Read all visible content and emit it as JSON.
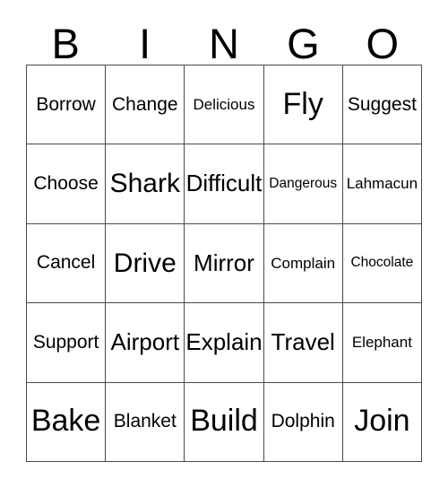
{
  "card": {
    "headers": [
      "B",
      "I",
      "N",
      "G",
      "O"
    ],
    "rows": [
      [
        {
          "text": "Borrow",
          "size": "fs-sm"
        },
        {
          "text": "Change",
          "size": "fs-sm"
        },
        {
          "text": "Delicious",
          "size": "fs-xs"
        },
        {
          "text": "Fly",
          "size": "fs-xl"
        },
        {
          "text": "Suggest",
          "size": "fs-sm"
        }
      ],
      [
        {
          "text": "Choose",
          "size": "fs-sm"
        },
        {
          "text": "Shark",
          "size": "fs-lg"
        },
        {
          "text": "Difficult",
          "size": "fs-md"
        },
        {
          "text": "Dangerous",
          "size": "fs-xxs"
        },
        {
          "text": "Lahmacun",
          "size": "fs-xs"
        }
      ],
      [
        {
          "text": "Cancel",
          "size": "fs-sm"
        },
        {
          "text": "Drive",
          "size": "fs-lg"
        },
        {
          "text": "Mirror",
          "size": "fs-md"
        },
        {
          "text": "Complain",
          "size": "fs-xs"
        },
        {
          "text": "Chocolate",
          "size": "fs-xxs"
        }
      ],
      [
        {
          "text": "Support",
          "size": "fs-sm"
        },
        {
          "text": "Airport",
          "size": "fs-md"
        },
        {
          "text": "Explain",
          "size": "fs-md"
        },
        {
          "text": "Travel",
          "size": "fs-md"
        },
        {
          "text": "Elephant",
          "size": "fs-xs"
        }
      ],
      [
        {
          "text": "Bake",
          "size": "fs-xl"
        },
        {
          "text": "Blanket",
          "size": "fs-sm"
        },
        {
          "text": "Build",
          "size": "fs-xl"
        },
        {
          "text": "Dolphin",
          "size": "fs-sm"
        },
        {
          "text": "Join",
          "size": "fs-xl"
        }
      ]
    ]
  },
  "colors": {
    "background": "#ffffff",
    "text": "#000000",
    "grid_line": "#4a4a4a"
  }
}
